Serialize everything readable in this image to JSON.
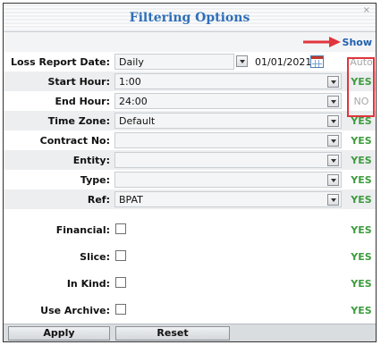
{
  "dialog": {
    "title": "Filtering Options",
    "close_glyph": "×"
  },
  "show": {
    "label": "Show"
  },
  "fields": {
    "loss_report_date": {
      "label": "Loss Report Date:",
      "value": "Daily",
      "date": "01/01/2021",
      "status": "Auto"
    },
    "start_hour": {
      "label": "Start Hour:",
      "value": "1:00",
      "status": "YES"
    },
    "end_hour": {
      "label": "End Hour:",
      "value": "24:00",
      "status": "NO"
    },
    "time_zone": {
      "label": "Time Zone:",
      "value": "Default",
      "status": "YES"
    },
    "contract_no": {
      "label": "Contract No:",
      "value": "",
      "status": "YES"
    },
    "entity": {
      "label": "Entity:",
      "value": "",
      "status": "YES"
    },
    "type": {
      "label": "Type:",
      "value": "",
      "status": "YES"
    },
    "ref": {
      "label": "Ref:",
      "value": "BPAT",
      "status": "YES"
    },
    "financial": {
      "label": "Financial:",
      "status": "YES"
    },
    "slice": {
      "label": "Slice:",
      "status": "YES"
    },
    "in_kind": {
      "label": "In Kind:",
      "status": "YES"
    },
    "use_archive": {
      "label": "Use Archive:",
      "status": "YES"
    }
  },
  "buttons": {
    "apply": "Apply",
    "reset": "Reset"
  },
  "icons": {
    "close": "close-icon",
    "arrow": "arrow-right-icon",
    "calendar": "calendar-icon",
    "dropdown": "chevron-down-icon"
  },
  "colors": {
    "title": "#2f6fb8",
    "yes": "#3d9c3d",
    "highlight": "#e0353d",
    "arrow": "#e0353d",
    "link": "#1f5fb0"
  }
}
